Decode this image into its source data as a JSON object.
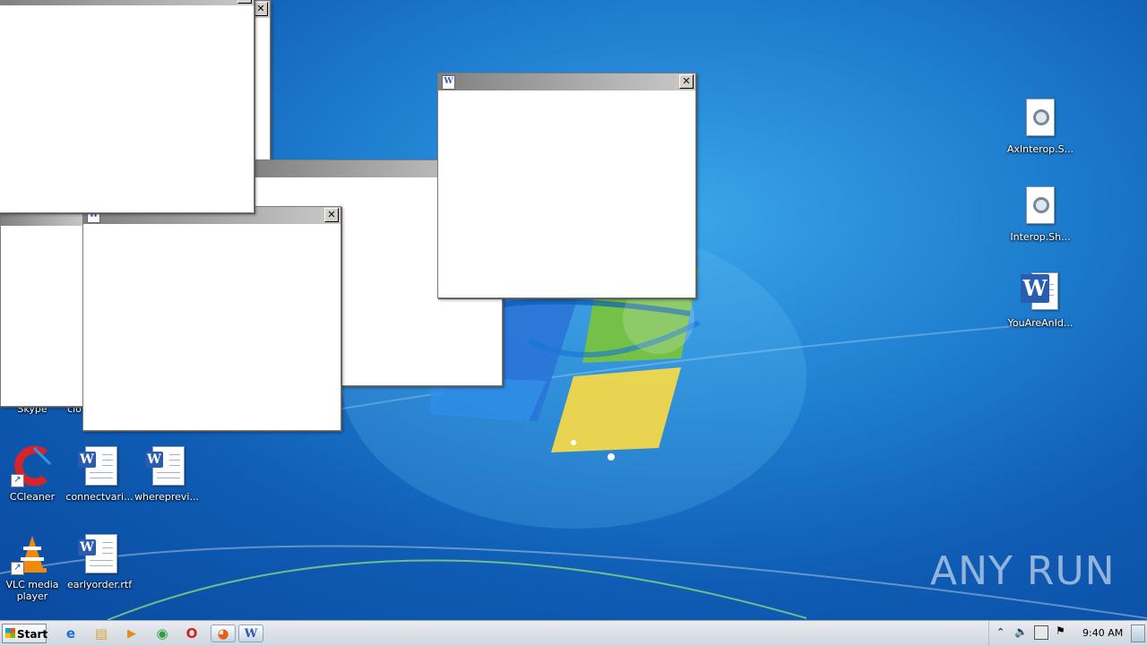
{
  "desktop": {
    "icons_left": [
      {
        "name": "skype",
        "label": "Skype",
        "kind": "shortcut-icon"
      },
      {
        "name": "cloud",
        "label": "clo",
        "kind": "doc-icon"
      },
      {
        "name": "ccleaner",
        "label": "CCleaner",
        "kind": "ccleaner-icon"
      },
      {
        "name": "connectvari",
        "label": "connectvari...",
        "kind": "word-doc-icon"
      },
      {
        "name": "whereprevi",
        "label": "whereprevi...",
        "kind": "word-doc-icon"
      },
      {
        "name": "vlc",
        "label": "VLC media player",
        "kind": "vlc-icon"
      },
      {
        "name": "earlyorder",
        "label": "earlyorder.rtf",
        "kind": "word-doc-icon"
      }
    ],
    "icons_right": [
      {
        "name": "axinterop",
        "label": "AxInterop.S...",
        "kind": "config-file-icon"
      },
      {
        "name": "interop",
        "label": "Interop.Sh...",
        "kind": "config-file-icon"
      },
      {
        "name": "youareanid",
        "label": "YouAreAnId...",
        "kind": "word-app-icon"
      }
    ],
    "watermark": "ANY RUN"
  },
  "windows": [
    {
      "name": "popup-window-1",
      "title": "",
      "close": "✕"
    },
    {
      "name": "popup-window-2",
      "title": "",
      "close": "✕"
    },
    {
      "name": "popup-window-3",
      "title": "",
      "close": "✕"
    },
    {
      "name": "popup-window-4",
      "title": "",
      "close": "✕"
    },
    {
      "name": "popup-window-5",
      "title": "",
      "close": "✕"
    },
    {
      "name": "popup-window-6",
      "title": "",
      "close": "✕"
    }
  ],
  "taskbar": {
    "start_label": "Start",
    "pinned": [
      {
        "name": "internet-explorer-icon",
        "glyph": "e",
        "color": "#1f6fd0"
      },
      {
        "name": "explorer-folder-icon",
        "glyph": "▤",
        "color": "#d9a63a"
      },
      {
        "name": "media-player-icon",
        "glyph": "▶",
        "color": "#e58a1c"
      },
      {
        "name": "chrome-icon",
        "glyph": "◉",
        "color": "#2f9e44"
      },
      {
        "name": "opera-icon",
        "glyph": "O",
        "color": "#d21f1f"
      },
      {
        "name": "firefox-icon",
        "glyph": "◕",
        "color": "#e8611a"
      },
      {
        "name": "word-icon",
        "glyph": "W",
        "color": "#2a5db0"
      }
    ],
    "tray": {
      "clock": "9:40 AM",
      "icons": [
        "show-hidden-icons-icon",
        "volume-icon",
        "network-icon",
        "action-center-flag-icon"
      ]
    }
  }
}
